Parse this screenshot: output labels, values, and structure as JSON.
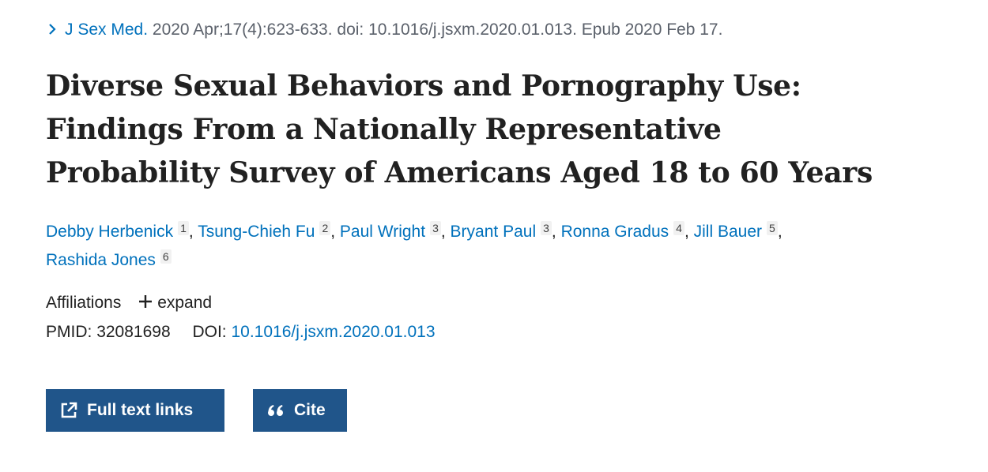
{
  "citation": {
    "journal": "J Sex Med.",
    "details": "2020 Apr;17(4):623-633. doi: 10.1016/j.jsxm.2020.01.013. Epub 2020 Feb 17."
  },
  "title_lines": [
    "Diverse Sexual Behaviors and Pornography Use:",
    "Findings From a Nationally Representative",
    "Probability Survey of Americans Aged 18 to 60 Years"
  ],
  "authors": [
    {
      "name": "Debby Herbenick",
      "aff": "1"
    },
    {
      "name": "Tsung-Chieh Fu",
      "aff": "2"
    },
    {
      "name": "Paul Wright",
      "aff": "3"
    },
    {
      "name": "Bryant Paul",
      "aff": "3"
    },
    {
      "name": "Ronna Gradus",
      "aff": "4"
    },
    {
      "name": "Jill Bauer",
      "aff": "5"
    },
    {
      "name": "Rashida Jones",
      "aff": "6"
    }
  ],
  "affiliations": {
    "label": "Affiliations",
    "expand": "expand"
  },
  "ids": {
    "pmid_label": "PMID:",
    "pmid": "32081698",
    "doi_label": "DOI:",
    "doi": "10.1016/j.jsxm.2020.01.013"
  },
  "buttons": {
    "full_text": "Full text links",
    "cite": "Cite"
  },
  "colors": {
    "link": "#0071bc",
    "button": "#20558a"
  },
  "icons": [
    "chevron-right-icon",
    "plus-icon",
    "external-link-icon",
    "quote-icon"
  ]
}
